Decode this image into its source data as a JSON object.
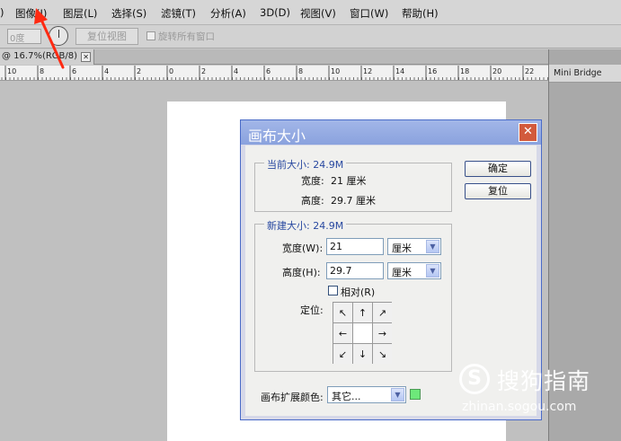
{
  "menubar": {
    "items": [
      "图像(I)",
      "图层(L)",
      "选择(S)",
      "滤镜(T)",
      "分析(A)",
      "3D(D)",
      "视图(V)",
      "窗口(W)",
      "帮助(H)"
    ],
    "left_fragment": ")"
  },
  "options_bar": {
    "angle_value": "0度",
    "reset_view_label": "复位视图",
    "rotate_all_label": "旋转所有窗口"
  },
  "document_tab": {
    "title": "@ 16.7%(RGB/8)",
    "close_glyph": "✕"
  },
  "ruler": {
    "labels": [
      "10",
      "8",
      "6",
      "4",
      "2",
      "0",
      "2",
      "4",
      "6",
      "8",
      "10",
      "12",
      "14",
      "16",
      "18",
      "20",
      "22"
    ]
  },
  "panel": {
    "mini_bridge_label": "Mini Bridge"
  },
  "dialog": {
    "title": "画布大小",
    "close_glyph": "✕",
    "current_size": {
      "title": "当前大小: 24.9M",
      "width_label": "宽度:",
      "width_value": "21 厘米",
      "height_label": "高度:",
      "height_value": "29.7 厘米"
    },
    "new_size": {
      "title": "新建大小: 24.9M",
      "width_label": "宽度(W):",
      "width_value": "21",
      "width_unit": "厘米",
      "height_label": "高度(H):",
      "height_value": "29.7",
      "height_unit": "厘米",
      "relative_label": "相对(R)",
      "relative_checked": false,
      "anchor_label": "定位:",
      "anchor_arrows": [
        "↖",
        "↑",
        "↗",
        "←",
        "",
        "→",
        "↙",
        "↓",
        "↘"
      ]
    },
    "ok_label": "确定",
    "reset_label": "复位",
    "extension_color_label": "画布扩展颜色:",
    "extension_color_value": "其它...",
    "extension_color_swatch": "#6de97a"
  },
  "annotation_color": "#ff2a12",
  "watermark": {
    "logo_glyph": "S",
    "text": "搜狗指南",
    "url": "zhinan.sogou.com"
  }
}
